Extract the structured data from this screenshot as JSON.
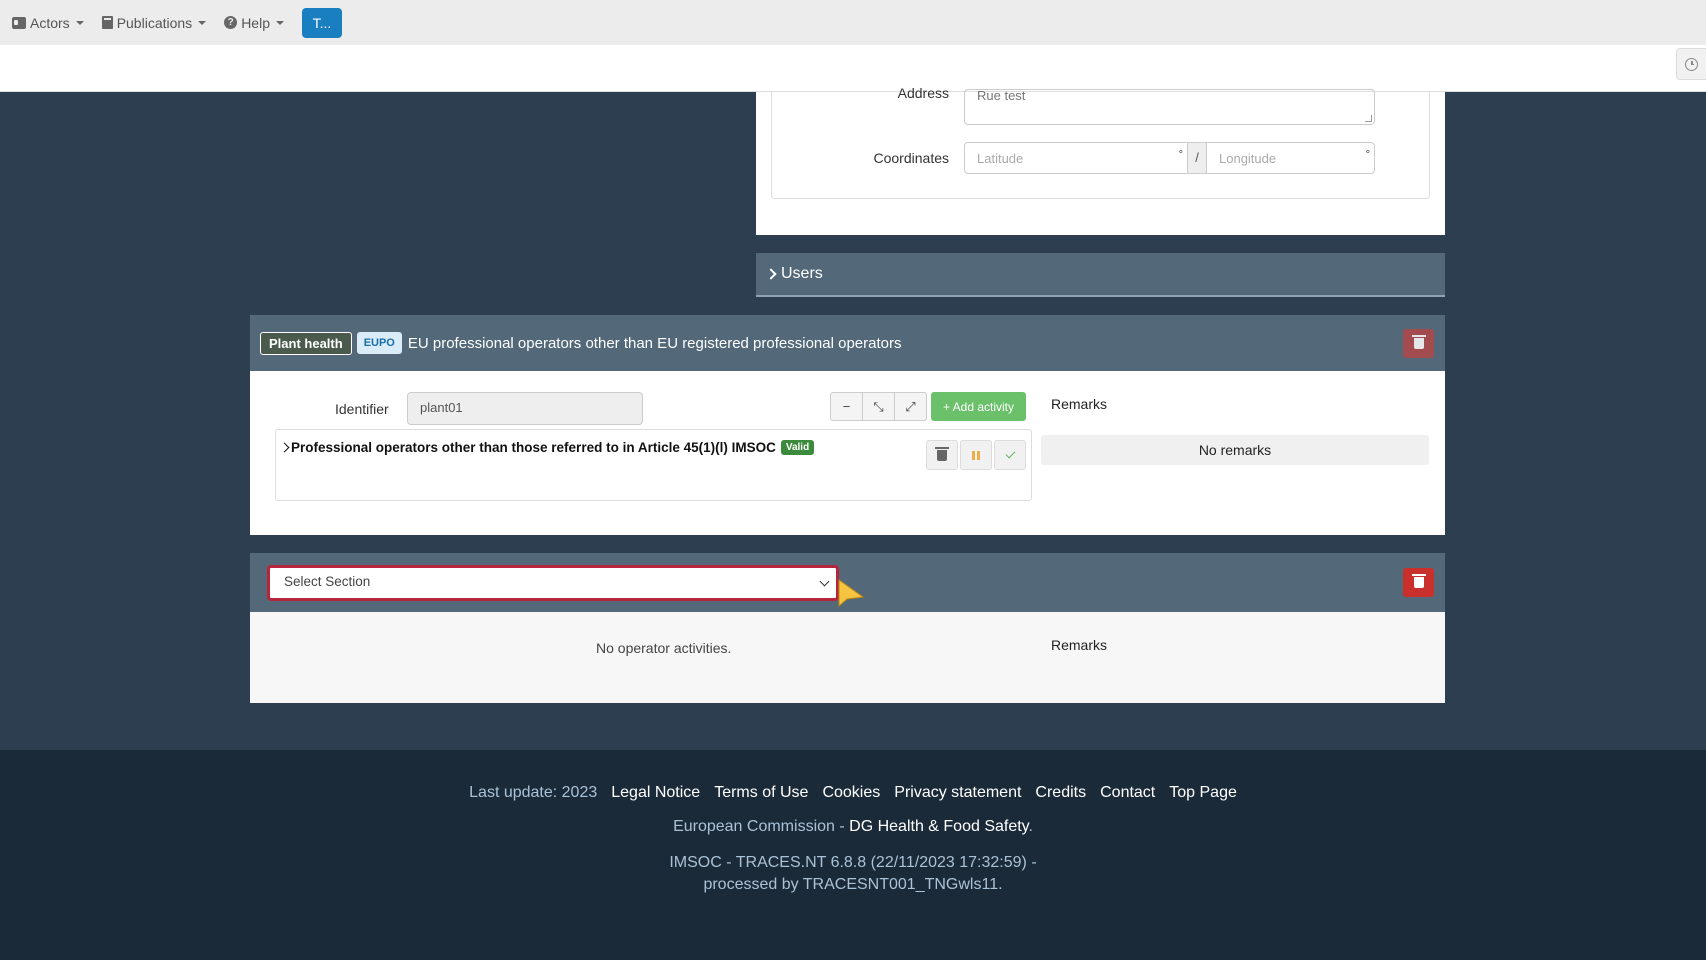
{
  "nav": {
    "actors": "Actors",
    "publications": "Publications",
    "help": "Help",
    "t_button": "T..."
  },
  "address": {
    "label": "Address",
    "value": "Rue test",
    "coordinates_label": "Coordinates",
    "lat_placeholder": "Latitude",
    "lon_placeholder": "Longitude",
    "degree": "°",
    "separator": "/"
  },
  "users": {
    "label": "Users"
  },
  "plant_health": {
    "badge": "Plant health",
    "code": "EUPO",
    "title": "EU professional operators other than EU registered professional operators",
    "identifier_label": "Identifier",
    "identifier_value": "plant01",
    "add_activity": "+ Add activity",
    "remarks_label": "Remarks",
    "no_remarks": "No remarks",
    "activity": {
      "title": "Professional operators other than those referred to in Article 45(1)(l) IMSOC",
      "status": "Valid"
    }
  },
  "new_section": {
    "select_value": "Select Section",
    "no_activities": "No operator activities.",
    "remarks_label": "Remarks"
  },
  "footer": {
    "last_update": "Last update: 2023",
    "links": [
      "Legal Notice",
      "Terms of Use",
      "Cookies",
      "Privacy statement",
      "Credits",
      "Contact",
      "Top Page"
    ],
    "commission": "European Commission - ",
    "dg": "DG Health & Food Safety",
    "dot": ".",
    "version_line1": "IMSOC - TRACES.NT 6.8.8 (22/11/2023 17:32:59) -",
    "version_line2": "processed by TRACESNT001_TNGwls11."
  },
  "colors": {
    "page_bg": "#2c3e4f",
    "panel_header": "#536878",
    "danger": "#c9302c",
    "success": "#6ac16a",
    "primary": "#1a7fc1",
    "footer_bg": "#1b2a38"
  }
}
